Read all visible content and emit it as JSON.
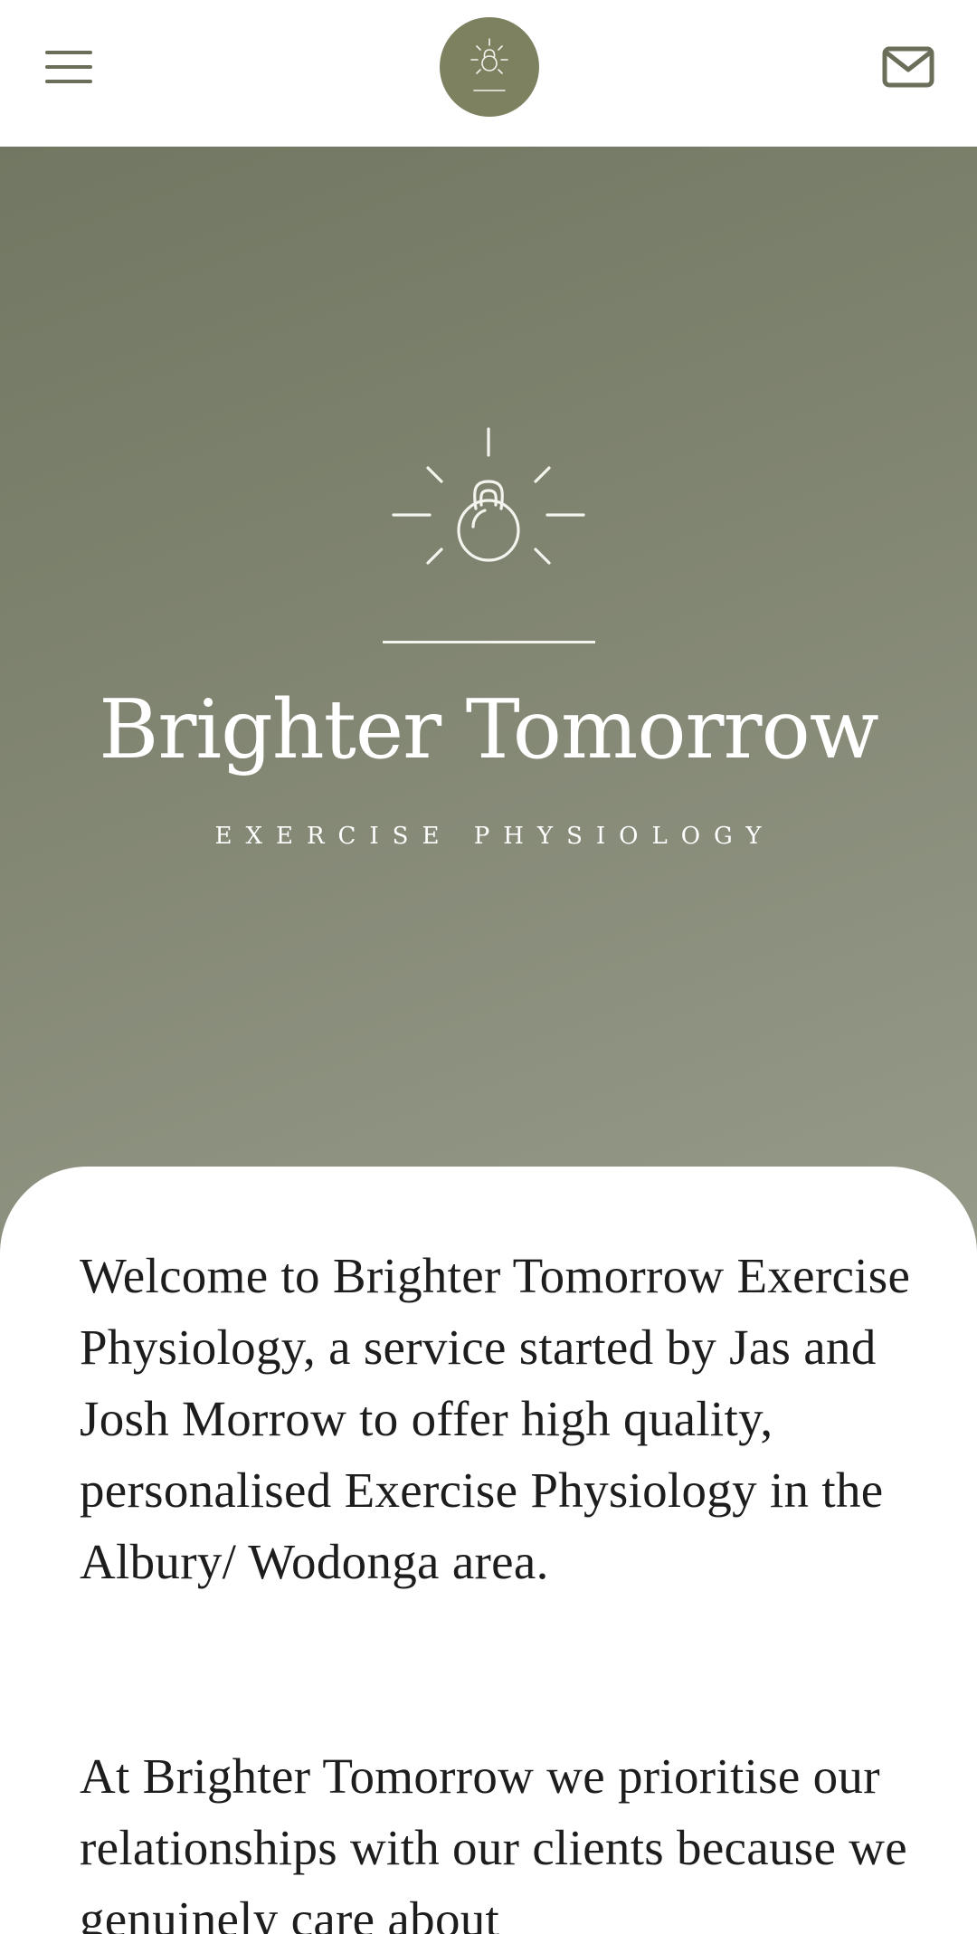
{
  "header": {
    "menu_icon": "hamburger-menu-icon",
    "logo_icon": "kettlebell-sun-logo",
    "mail_icon": "mail-envelope-icon"
  },
  "hero": {
    "icon": "kettlebell-sunrise-icon",
    "title": "Brighter Tomorrow",
    "subtitle": "EXERCISE PHYSIOLOGY"
  },
  "content": {
    "paragraphs": [
      "Welcome to Brighter Tomorrow Exercise Physiology, a service started by Jas and Josh Morrow to offer high quality, personalised Exercise Physiology in the Albury/ Wodonga area.",
      "At Brighter Tomorrow we prioritise our relationships with our clients because we genuinely care about"
    ]
  },
  "colors": {
    "brand_olive": "#7d8160",
    "hero_gradient_start": "#717762",
    "hero_gradient_end": "#969a89",
    "text_dark": "#1d1d1d",
    "icon_gray": "#6b6f5a"
  }
}
